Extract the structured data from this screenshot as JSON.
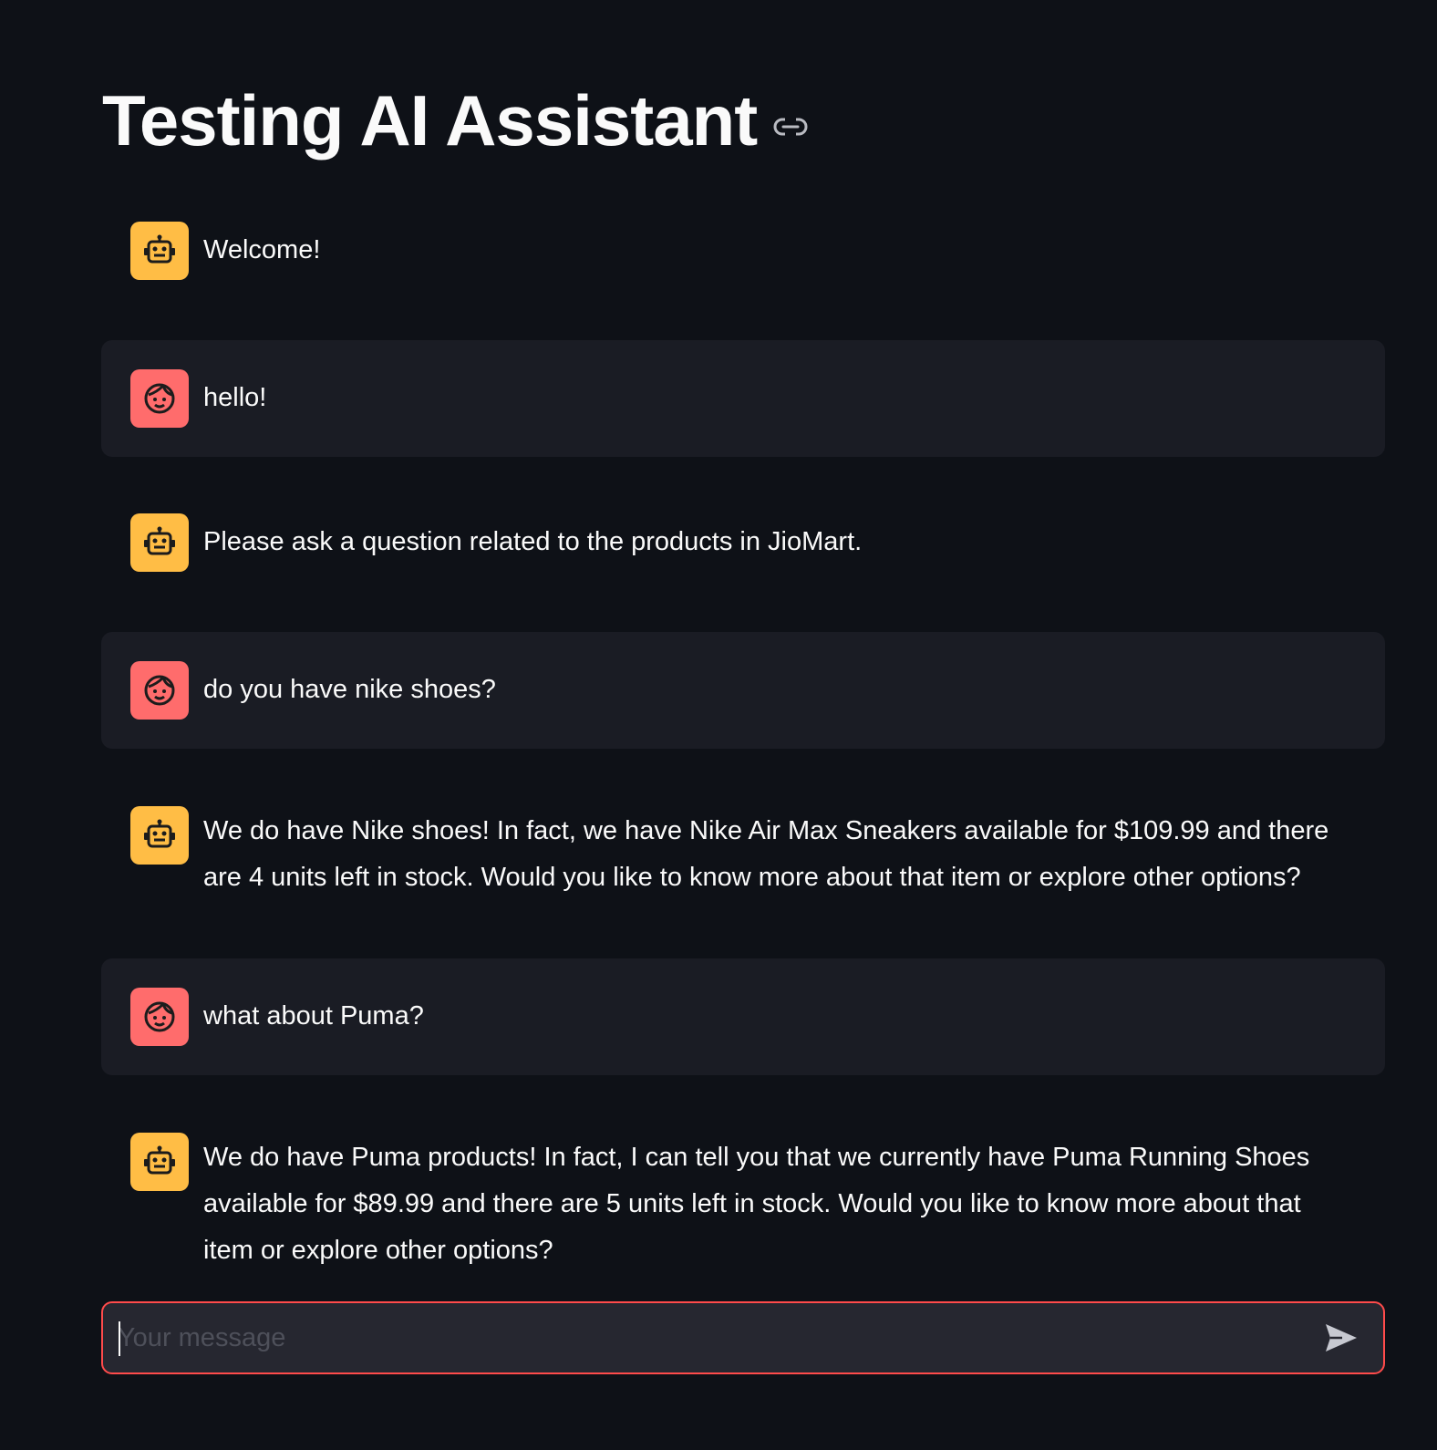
{
  "page": {
    "title": "Testing AI Assistant"
  },
  "messages": [
    {
      "role": "assistant",
      "avatar_icon": "robot-icon",
      "text": "Welcome!"
    },
    {
      "role": "user",
      "avatar_icon": "user-face-icon",
      "text": "hello!"
    },
    {
      "role": "assistant",
      "avatar_icon": "robot-icon",
      "text": "Please ask a question related to the products in JioMart."
    },
    {
      "role": "user",
      "avatar_icon": "user-face-icon",
      "text": "do you have nike shoes?"
    },
    {
      "role": "assistant",
      "avatar_icon": "robot-icon",
      "text": "We do have Nike shoes! In fact, we have Nike Air Max Sneakers available for $109.99 and there are 4 units left in stock. Would you like to know more about that item or explore other options?"
    },
    {
      "role": "user",
      "avatar_icon": "user-face-icon",
      "text": "what about Puma?"
    },
    {
      "role": "assistant",
      "avatar_icon": "robot-icon",
      "text": "We do have Puma products! In fact, I can tell you that we currently have Puma Running Shoes available for $89.99 and there are 5 units left in stock. Would you like to know more about that item or explore other options?"
    }
  ],
  "chat_input": {
    "value": "",
    "placeholder": "Your message"
  },
  "colors": {
    "background": "#0e1117",
    "user_bubble": "#1a1c24",
    "assistant_avatar": "#ffbd45",
    "user_avatar": "#ff6c6c",
    "input_border_focus": "#ff4b4b",
    "input_background": "#262730"
  }
}
